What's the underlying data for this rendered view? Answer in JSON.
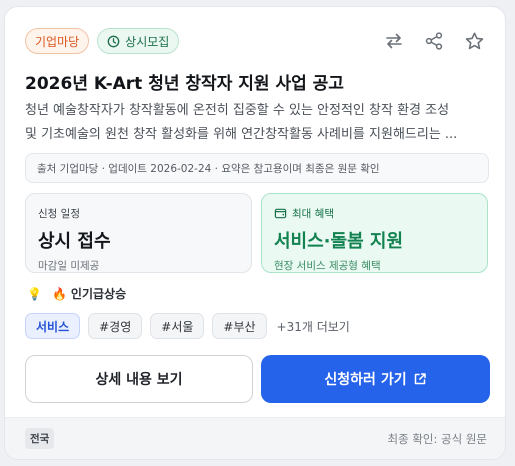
{
  "card": {
    "badges": {
      "organization": "기업마당",
      "status": "상시모집"
    },
    "actions": {
      "compare_icon": "swap-arrows-icon",
      "share_icon": "share-icon",
      "bookmark_icon": "star-icon"
    },
    "title": "2026년 K-Art 청년 창작자 지원 사업 공고",
    "description_line1": "청년 예술창작자가 창작활동에 온전히 집중할 수 있는 안정적인 창작 환경 조성",
    "description_line2": "및 기초예술의 원천 창작 활성화를 위해 연간창작활동 사례비를 지원해드리는 ...",
    "meta": "출처 기업마당 · 업데이트 2026-02-24 · 요약은 참고용이며 최종은 원문 확인",
    "schedule": {
      "label": "신청 일정",
      "value": "상시 접수",
      "sub": "마감일 미제공"
    },
    "benefit": {
      "icon": "wallet-icon",
      "label": "최대 혜택",
      "value": "서비스·돌봄 지원",
      "sub": "현장 서비스 제공형 혜택"
    },
    "trend": {
      "bulb_icon": "bulb-icon",
      "fire_icon": "fire-icon",
      "label": "인기급상승"
    },
    "tags": [
      "서비스",
      "#경영",
      "#서울",
      "#부산"
    ],
    "more_tags": "+31개 더보기",
    "buttons": {
      "detail": "상세 내용 보기",
      "apply": "신청하러 가기",
      "apply_icon": "external-link-icon"
    },
    "footer": {
      "region": "전국",
      "note": "최종 확인: 공식 원문"
    }
  },
  "colors": {
    "accent": "#2563eb",
    "benefit_green": "#128251",
    "org_orange": "#d9551d",
    "status_green": "#1d6e4b"
  }
}
